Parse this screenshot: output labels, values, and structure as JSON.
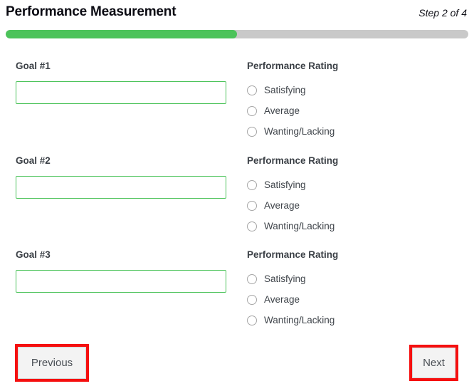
{
  "header": {
    "title": "Performance Measurement",
    "step_text": "Step 2 of 4"
  },
  "progress": {
    "percent": 50,
    "fill_color": "#4cc35a",
    "track_color": "#c9c9c9"
  },
  "goals": [
    {
      "label": "Goal #1",
      "value": "",
      "placeholder": ""
    },
    {
      "label": "Goal #2",
      "value": "",
      "placeholder": ""
    },
    {
      "label": "Goal #3",
      "value": "",
      "placeholder": ""
    }
  ],
  "ratings": [
    {
      "title": "Performance Rating",
      "options": [
        {
          "label": "Satisfying",
          "selected": false
        },
        {
          "label": "Average",
          "selected": false
        },
        {
          "label": "Wanting/Lacking",
          "selected": false
        }
      ]
    },
    {
      "title": "Performance Rating",
      "options": [
        {
          "label": "Satisfying",
          "selected": false
        },
        {
          "label": "Average",
          "selected": false
        },
        {
          "label": "Wanting/Lacking",
          "selected": false
        }
      ]
    },
    {
      "title": "Performance Rating",
      "options": [
        {
          "label": "Satisfying",
          "selected": false
        },
        {
          "label": "Average",
          "selected": false
        },
        {
          "label": "Wanting/Lacking",
          "selected": false
        }
      ]
    }
  ],
  "footer": {
    "previous_label": "Previous",
    "next_label": "Next",
    "highlight_color": "#f50f0f"
  }
}
